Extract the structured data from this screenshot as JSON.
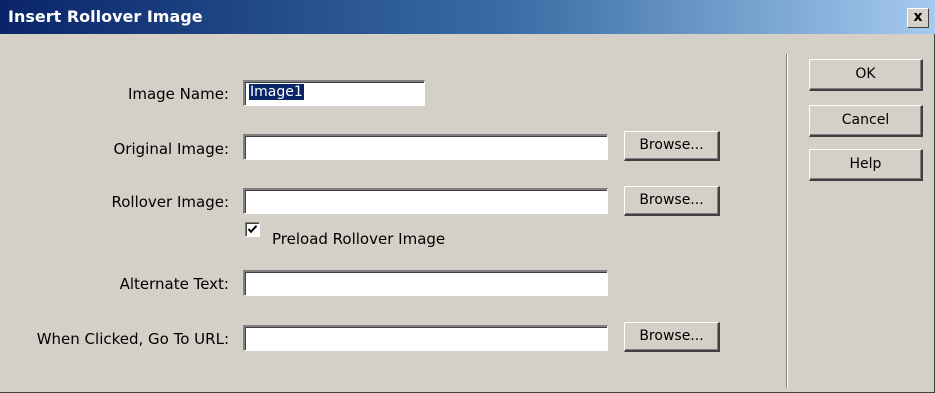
{
  "window": {
    "title": "Insert Rollover Image",
    "close_glyph": "x"
  },
  "form": {
    "image_name": {
      "label": "Image Name:",
      "value": "Image1"
    },
    "original_image": {
      "label": "Original Image:",
      "value": "",
      "browse_label": "Browse..."
    },
    "rollover_image": {
      "label": "Rollover Image:",
      "value": "",
      "browse_label": "Browse..."
    },
    "preload": {
      "label": "Preload Rollover Image",
      "checked": true
    },
    "alternate_text": {
      "label": "Alternate Text:",
      "value": ""
    },
    "url": {
      "label": "When Clicked, Go To URL:",
      "value": "",
      "browse_label": "Browse..."
    }
  },
  "actions": {
    "ok_label": "OK",
    "cancel_label": "Cancel",
    "help_label": "Help"
  },
  "colors": {
    "titlebar_start": "#0a246a",
    "titlebar_end": "#a6caf0",
    "dialog_bg": "#d4d0c8",
    "selection": "#0a246a"
  }
}
